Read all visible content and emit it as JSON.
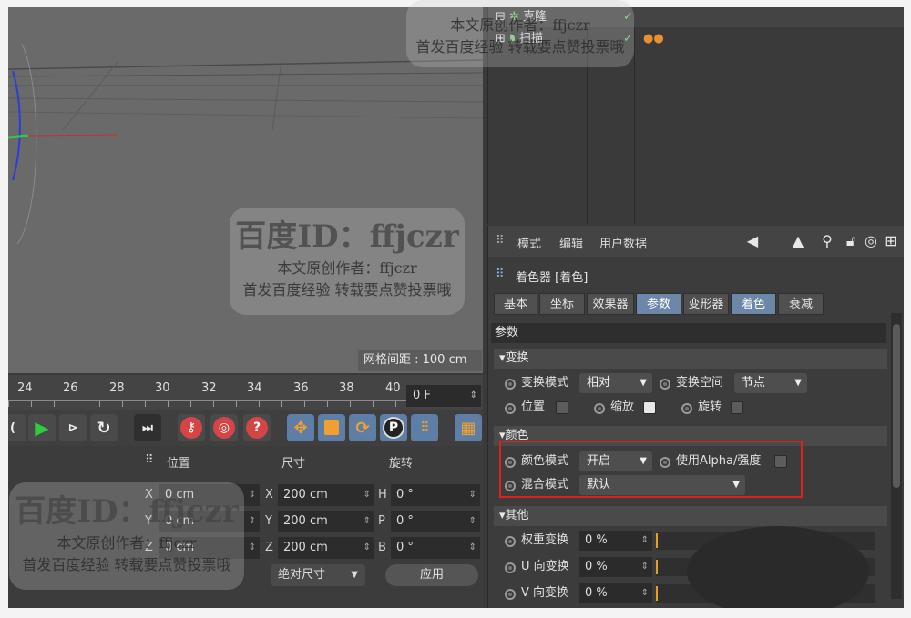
{
  "viewport": {
    "grid_spacing": "网格间距 : 100 cm"
  },
  "timeline": {
    "ticks": [
      "24",
      "26",
      "28",
      "30",
      "32",
      "34",
      "36",
      "38",
      "40"
    ],
    "current_frame": "0 F"
  },
  "coordinates": {
    "headers": [
      "位置",
      "尺寸",
      "旋转"
    ],
    "rows": [
      {
        "pos_axis": "X",
        "pos": "0 cm",
        "size_axis": "X",
        "size": "200 cm",
        "rot_axis": "H",
        "rot": "0 °"
      },
      {
        "pos_axis": "Y",
        "pos": "0 cm",
        "size_axis": "Y",
        "size": "200 cm",
        "rot_axis": "P",
        "rot": "0 °"
      },
      {
        "pos_axis": "Z",
        "pos": "0 cm",
        "size_axis": "Z",
        "size": "200 cm",
        "rot_axis": "B",
        "rot": "0 °"
      }
    ],
    "size_mode": "绝对尺寸",
    "apply": "应用"
  },
  "objects": {
    "items": [
      "克隆",
      "扫描"
    ]
  },
  "attributes": {
    "menu": [
      "模式",
      "编辑",
      "用户数据"
    ],
    "title": "着色器 [着色]",
    "tabs": [
      "基本",
      "坐标",
      "效果器",
      "参数",
      "变形器",
      "着色",
      "衰减"
    ],
    "section": "参数",
    "groups": {
      "transform": {
        "title": "变换",
        "mode_label": "变换模式",
        "mode_value": "相对",
        "space_label": "变换空间",
        "space_value": "节点",
        "position": "位置",
        "scale": "缩放",
        "rotation": "旋转"
      },
      "color": {
        "title": "颜色",
        "mode_label": "颜色模式",
        "mode_value": "开启",
        "alpha_label": "使用Alpha/强度",
        "blend_label": "混合模式",
        "blend_value": "默认"
      },
      "other": {
        "title": "其他",
        "rows": [
          {
            "label": "权重变换",
            "value": "0 %"
          },
          {
            "label": "U 向变换",
            "value": "0 %"
          },
          {
            "label": "V 向变换",
            "value": "0 %"
          }
        ]
      }
    }
  },
  "watermark": {
    "id": "百度ID：ffjczr",
    "line1": "本文原创作者：ffjczr",
    "line2": "首发百度经验  转载要点赞投票哦"
  },
  "colors": {
    "highlight": "#e02020",
    "active_tab": "#6d87a8",
    "play": "#2ecc40",
    "record": "#d64545"
  }
}
